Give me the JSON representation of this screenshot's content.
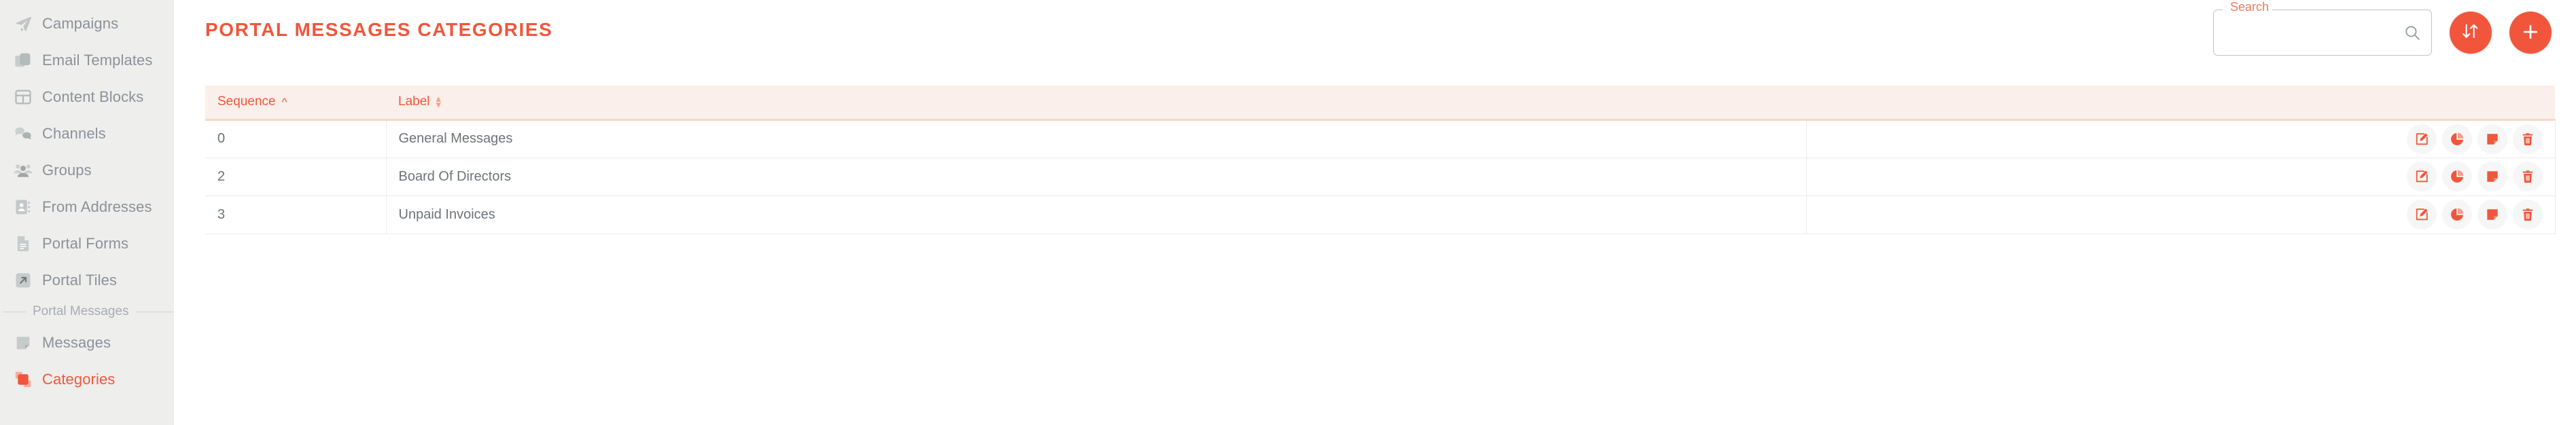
{
  "sidebar": {
    "items": [
      {
        "label": "Campaigns",
        "icon": "paper-plane-icon",
        "active": false
      },
      {
        "label": "Email Templates",
        "icon": "copy-icon",
        "active": false
      },
      {
        "label": "Content Blocks",
        "icon": "grid-table-icon",
        "active": false
      },
      {
        "label": "Channels",
        "icon": "chat-bubbles-icon",
        "active": false
      },
      {
        "label": "Groups",
        "icon": "users-group-icon",
        "active": false
      },
      {
        "label": "From Addresses",
        "icon": "address-book-icon",
        "active": false
      },
      {
        "label": "Portal Forms",
        "icon": "document-icon",
        "active": false
      },
      {
        "label": "Portal Tiles",
        "icon": "arrow-out-icon",
        "active": false
      }
    ],
    "section_label": "Portal Messages",
    "sub_items": [
      {
        "label": "Messages",
        "icon": "note-icon",
        "active": false
      },
      {
        "label": "Categories",
        "icon": "categories-icon",
        "active": true
      }
    ]
  },
  "header": {
    "title": "Portal Messages Categories"
  },
  "search": {
    "label": "Search",
    "value": "",
    "placeholder": "",
    "icon": "search-icon"
  },
  "toolbar": {
    "sort_button": {
      "icon": "sort-arrows-icon",
      "label": "Sort"
    },
    "add_button": {
      "icon": "plus-icon",
      "label": "Add"
    }
  },
  "table": {
    "columns": [
      {
        "label": "Sequence",
        "sort": "asc"
      },
      {
        "label": "Label",
        "sort": "none"
      },
      {
        "label": "",
        "sort": "none"
      }
    ],
    "rows": [
      {
        "sequence": "0",
        "label": "General Messages"
      },
      {
        "sequence": "2",
        "label": "Board Of Directors"
      },
      {
        "sequence": "3",
        "label": "Unpaid Invoices"
      }
    ],
    "row_actions": [
      {
        "name": "edit",
        "icon": "edit-pencil-icon"
      },
      {
        "name": "statistics",
        "icon": "pie-chart-icon"
      },
      {
        "name": "messages",
        "icon": "note-icon"
      },
      {
        "name": "delete",
        "icon": "trash-icon"
      }
    ]
  },
  "colors": {
    "accent": "#F1563C",
    "sidebar_bg": "#EEEEEC",
    "table_header_bg": "#FAEFEA",
    "muted_text": "#8A9299"
  }
}
